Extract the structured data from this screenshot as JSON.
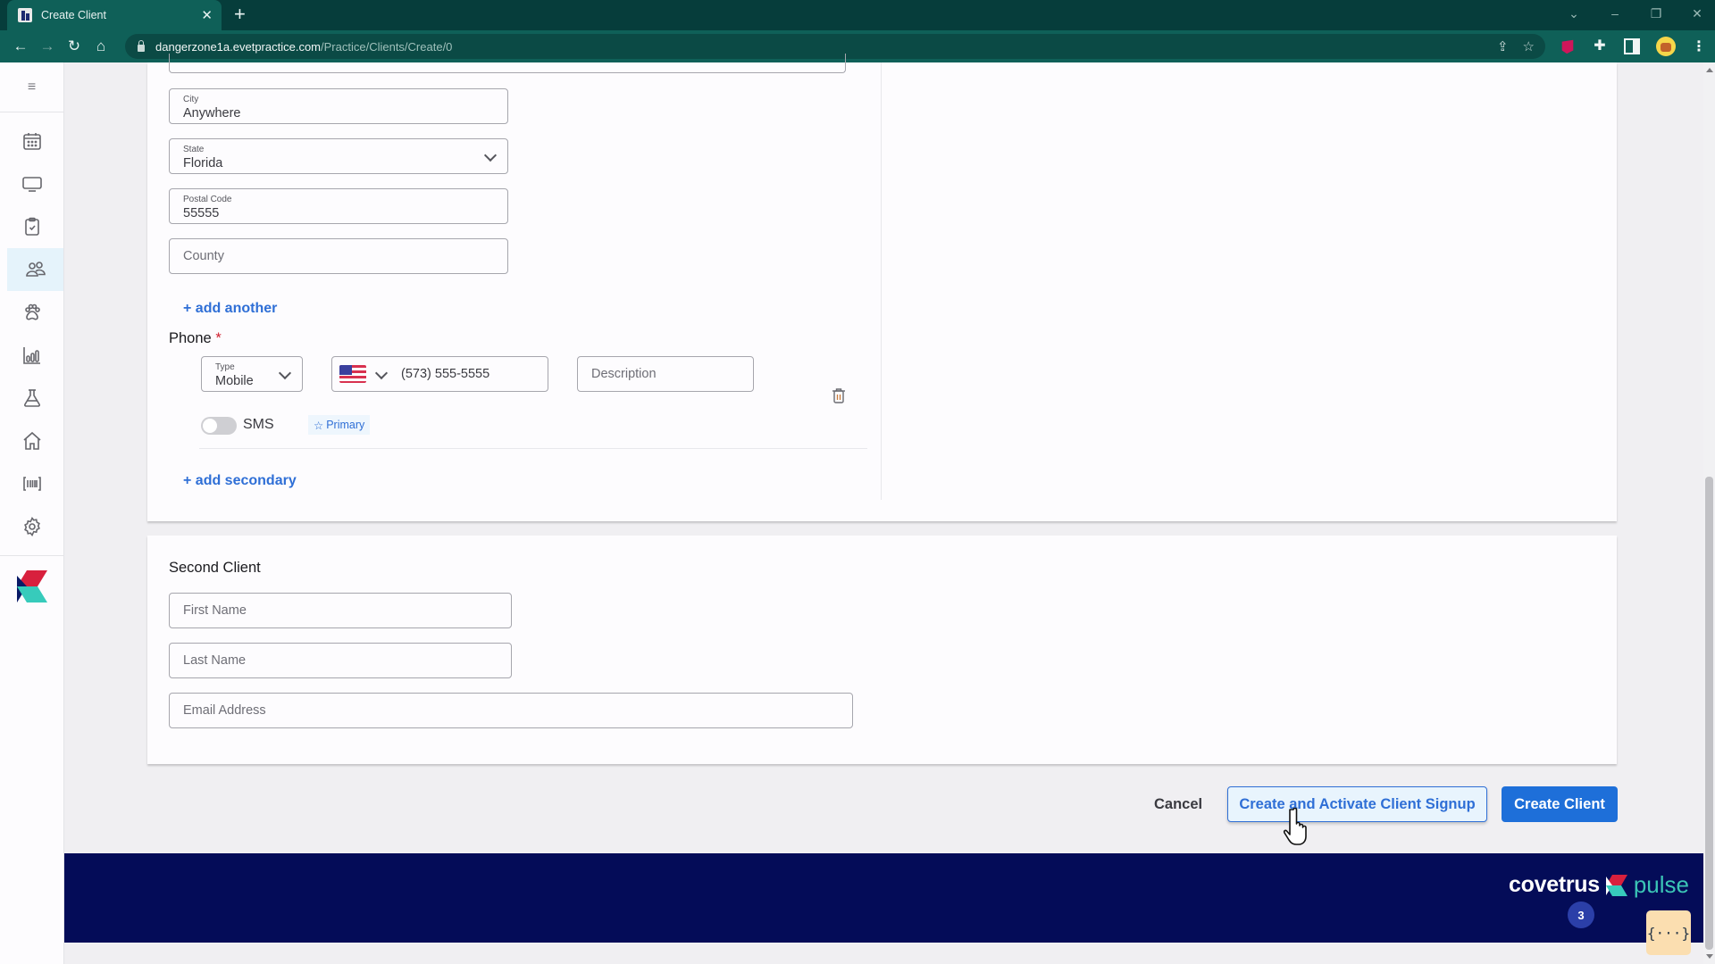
{
  "browser": {
    "tab_title": "Create Client",
    "tab_close": "✕",
    "new_tab": "+",
    "url_host": "dangerzone1a.evetpractice.com",
    "url_path": "/Practice/Clients/Create/0",
    "nav": {
      "back": "←",
      "forward": "→",
      "reload": "↻",
      "home": "⌂"
    },
    "window_controls": {
      "tab_search": "⌄",
      "minimize": "–",
      "restore": "❐",
      "close": "✕"
    },
    "omnibox_icons": {
      "share": "⇪",
      "bookmark": "☆"
    },
    "menu": "⋮",
    "puzzle": "✚"
  },
  "sidebar": {
    "menu_glyph": "≡",
    "items": [
      {
        "name": "calendar",
        "active": false
      },
      {
        "name": "monitor",
        "active": false
      },
      {
        "name": "clipboard",
        "active": false
      },
      {
        "name": "clients",
        "active": true
      },
      {
        "name": "patients",
        "active": false
      },
      {
        "name": "reports",
        "active": false
      },
      {
        "name": "lab",
        "active": false
      },
      {
        "name": "home",
        "active": false
      },
      {
        "name": "barcode",
        "active": false
      },
      {
        "name": "settings",
        "active": false
      }
    ]
  },
  "address": {
    "city": {
      "label": "City",
      "value": "Anywhere"
    },
    "state": {
      "label": "State",
      "value": "Florida"
    },
    "postal_code": {
      "label": "Postal Code",
      "value": "55555"
    },
    "county": {
      "placeholder": "County",
      "value": ""
    },
    "add_another": "+ add another"
  },
  "phone": {
    "section_label": "Phone",
    "required_mark": "*",
    "type": {
      "label": "Type",
      "value": "Mobile"
    },
    "country": "US",
    "number": "(573) 555-5555",
    "description": {
      "placeholder": "Description",
      "value": ""
    },
    "sms_label": "SMS",
    "sms_enabled": false,
    "primary_label": "Primary",
    "primary_star": "☆",
    "add_secondary": "+ add secondary"
  },
  "second_client": {
    "title": "Second Client",
    "first_name": {
      "placeholder": "First Name",
      "value": ""
    },
    "last_name": {
      "placeholder": "Last Name",
      "value": ""
    },
    "email": {
      "placeholder": "Email Address",
      "value": ""
    }
  },
  "actions": {
    "cancel": "Cancel",
    "create_activate": "Create and Activate Client Signup",
    "create": "Create Client"
  },
  "footer": {
    "brand_word": "covetrus",
    "brand_product": "pulse",
    "notification_count": "3",
    "widget_glyph": "{···}"
  },
  "colors": {
    "accent_blue": "#1e6fd9",
    "link_blue": "#2f6fd6",
    "required_red": "#d01f2f",
    "footer_navy": "#040c58",
    "chrome_teal": "#0f6058"
  }
}
